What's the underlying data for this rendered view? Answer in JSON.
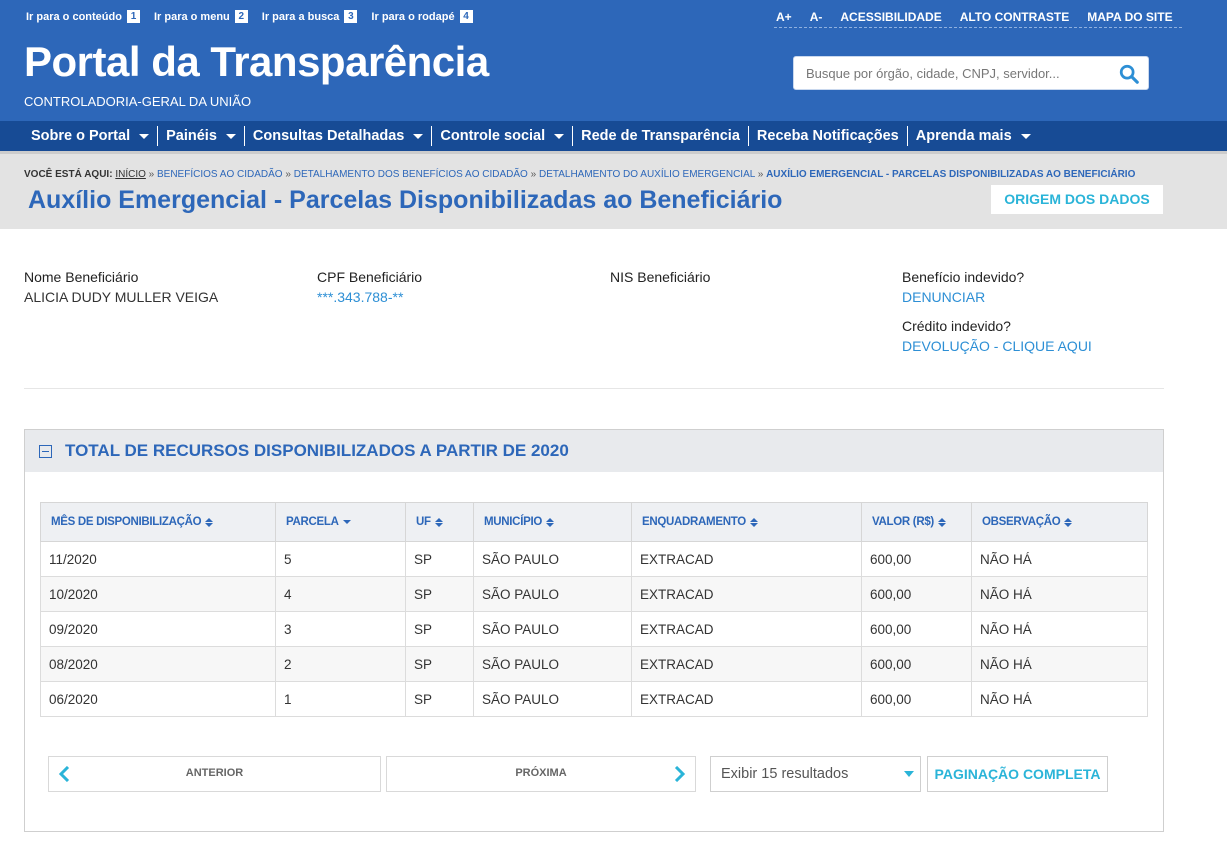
{
  "skip_links": [
    {
      "label": "Ir para o conteúdo",
      "num": "1"
    },
    {
      "label": "Ir para o menu",
      "num": "2"
    },
    {
      "label": "Ir para a busca",
      "num": "3"
    },
    {
      "label": "Ir para o rodapé",
      "num": "4"
    }
  ],
  "top_links": [
    "A+",
    "A-",
    "ACESSIBILIDADE",
    "ALTO CONTRASTE",
    "MAPA DO SITE"
  ],
  "site": {
    "title": "Portal da Transparência",
    "subtitle": "CONTROLADORIA-GERAL DA UNIÃO"
  },
  "search": {
    "placeholder": "Busque por órgão, cidade, CNPJ, servidor..."
  },
  "nav": [
    {
      "label": "Sobre o Portal",
      "dropdown": true
    },
    {
      "label": "Painéis",
      "dropdown": true
    },
    {
      "label": "Consultas Detalhadas",
      "dropdown": true
    },
    {
      "label": "Controle social",
      "dropdown": true
    },
    {
      "label": "Rede de Transparência",
      "dropdown": false
    },
    {
      "label": "Receba Notificações",
      "dropdown": false
    },
    {
      "label": "Aprenda mais",
      "dropdown": true
    }
  ],
  "breadcrumb": {
    "here": "VOCÊ ESTÁ AQUI:",
    "home": "INÍCIO",
    "items": [
      "BENEFÍCIOS AO CIDADÃO",
      "DETALHAMENTO DOS BENEFÍCIOS AO CIDADÃO",
      "DETALHAMENTO DO AUXÍLIO EMERGENCIAL"
    ],
    "current": "AUXÍLIO EMERGENCIAL - PARCELAS DISPONIBILIZADAS AO BENEFICIÁRIO"
  },
  "page": {
    "title": "Auxílio Emergencial - Parcelas Disponibilizadas ao Beneficiário",
    "origem_button": "ORIGEM DOS DADOS"
  },
  "beneficiary": {
    "name_label": "Nome Beneficiário",
    "name_value": "ALICIA DUDY MULLER VEIGA",
    "cpf_label": "CPF Beneficiário",
    "cpf_value": "***.343.788-**",
    "nis_label": "NIS Beneficiário",
    "indevido_label": "Benefício indevido?",
    "indevido_link": "DENUNCIAR",
    "credito_label": "Crédito indevido?",
    "credito_link": "DEVOLUÇÃO - CLIQUE AQUI"
  },
  "panel": {
    "title": "TOTAL DE RECURSOS DISPONIBILIZADOS A PARTIR DE 2020",
    "columns": [
      "MÊS DE DISPONIBILIZAÇÃO",
      "PARCELA",
      "UF",
      "MUNICÍPIO",
      "ENQUADRAMENTO",
      "VALOR (R$)",
      "OBSERVAÇÃO"
    ],
    "rows": [
      [
        "11/2020",
        "5",
        "SP",
        "SÃO PAULO",
        "EXTRACAD",
        "600,00",
        "NÃO HÁ"
      ],
      [
        "10/2020",
        "4",
        "SP",
        "SÃO PAULO",
        "EXTRACAD",
        "600,00",
        "NÃO HÁ"
      ],
      [
        "09/2020",
        "3",
        "SP",
        "SÃO PAULO",
        "EXTRACAD",
        "600,00",
        "NÃO HÁ"
      ],
      [
        "08/2020",
        "2",
        "SP",
        "SÃO PAULO",
        "EXTRACAD",
        "600,00",
        "NÃO HÁ"
      ],
      [
        "06/2020",
        "1",
        "SP",
        "SÃO PAULO",
        "EXTRACAD",
        "600,00",
        "NÃO HÁ"
      ]
    ]
  },
  "pagination": {
    "prev": "ANTERIOR",
    "next": "PRÓXIMA",
    "page_size": "Exibir 15 resultados",
    "full": "PAGINAÇÃO COMPLETA"
  },
  "colors": {
    "header_blue": "#2d67b9",
    "nav_blue": "#174b95",
    "accent_cyan": "#2ab4d8",
    "link_blue": "#2d8fd5"
  }
}
